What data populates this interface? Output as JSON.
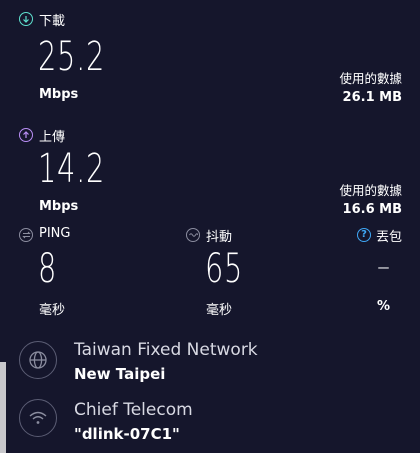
{
  "download": {
    "label": "下載",
    "value": "25.2",
    "unit": "Mbps",
    "data_used_label": "使用的數據",
    "data_used_value": "26.1 MB",
    "accent_color": "#5ee0cf"
  },
  "upload": {
    "label": "上傳",
    "value": "14.2",
    "unit": "Mbps",
    "data_used_label": "使用的數據",
    "data_used_value": "16.6 MB",
    "accent_color": "#b98ef5"
  },
  "ping": {
    "label": "PING",
    "value": "8",
    "unit": "毫秒"
  },
  "jitter": {
    "label": "抖動",
    "value": "65",
    "unit": "毫秒"
  },
  "packet_loss": {
    "label": "丟包",
    "value": "–",
    "unit": "%",
    "help_color": "#3fa7f5"
  },
  "server": {
    "provider": "Taiwan Fixed Network",
    "location": "New Taipei",
    "icon": "globe-icon"
  },
  "connection": {
    "provider": "Chief Telecom",
    "network": "\"dlink-07C1\"",
    "icon": "wifi-icon"
  },
  "colors": {
    "background": "#15162c",
    "icon_gray": "#8b8d9f"
  }
}
